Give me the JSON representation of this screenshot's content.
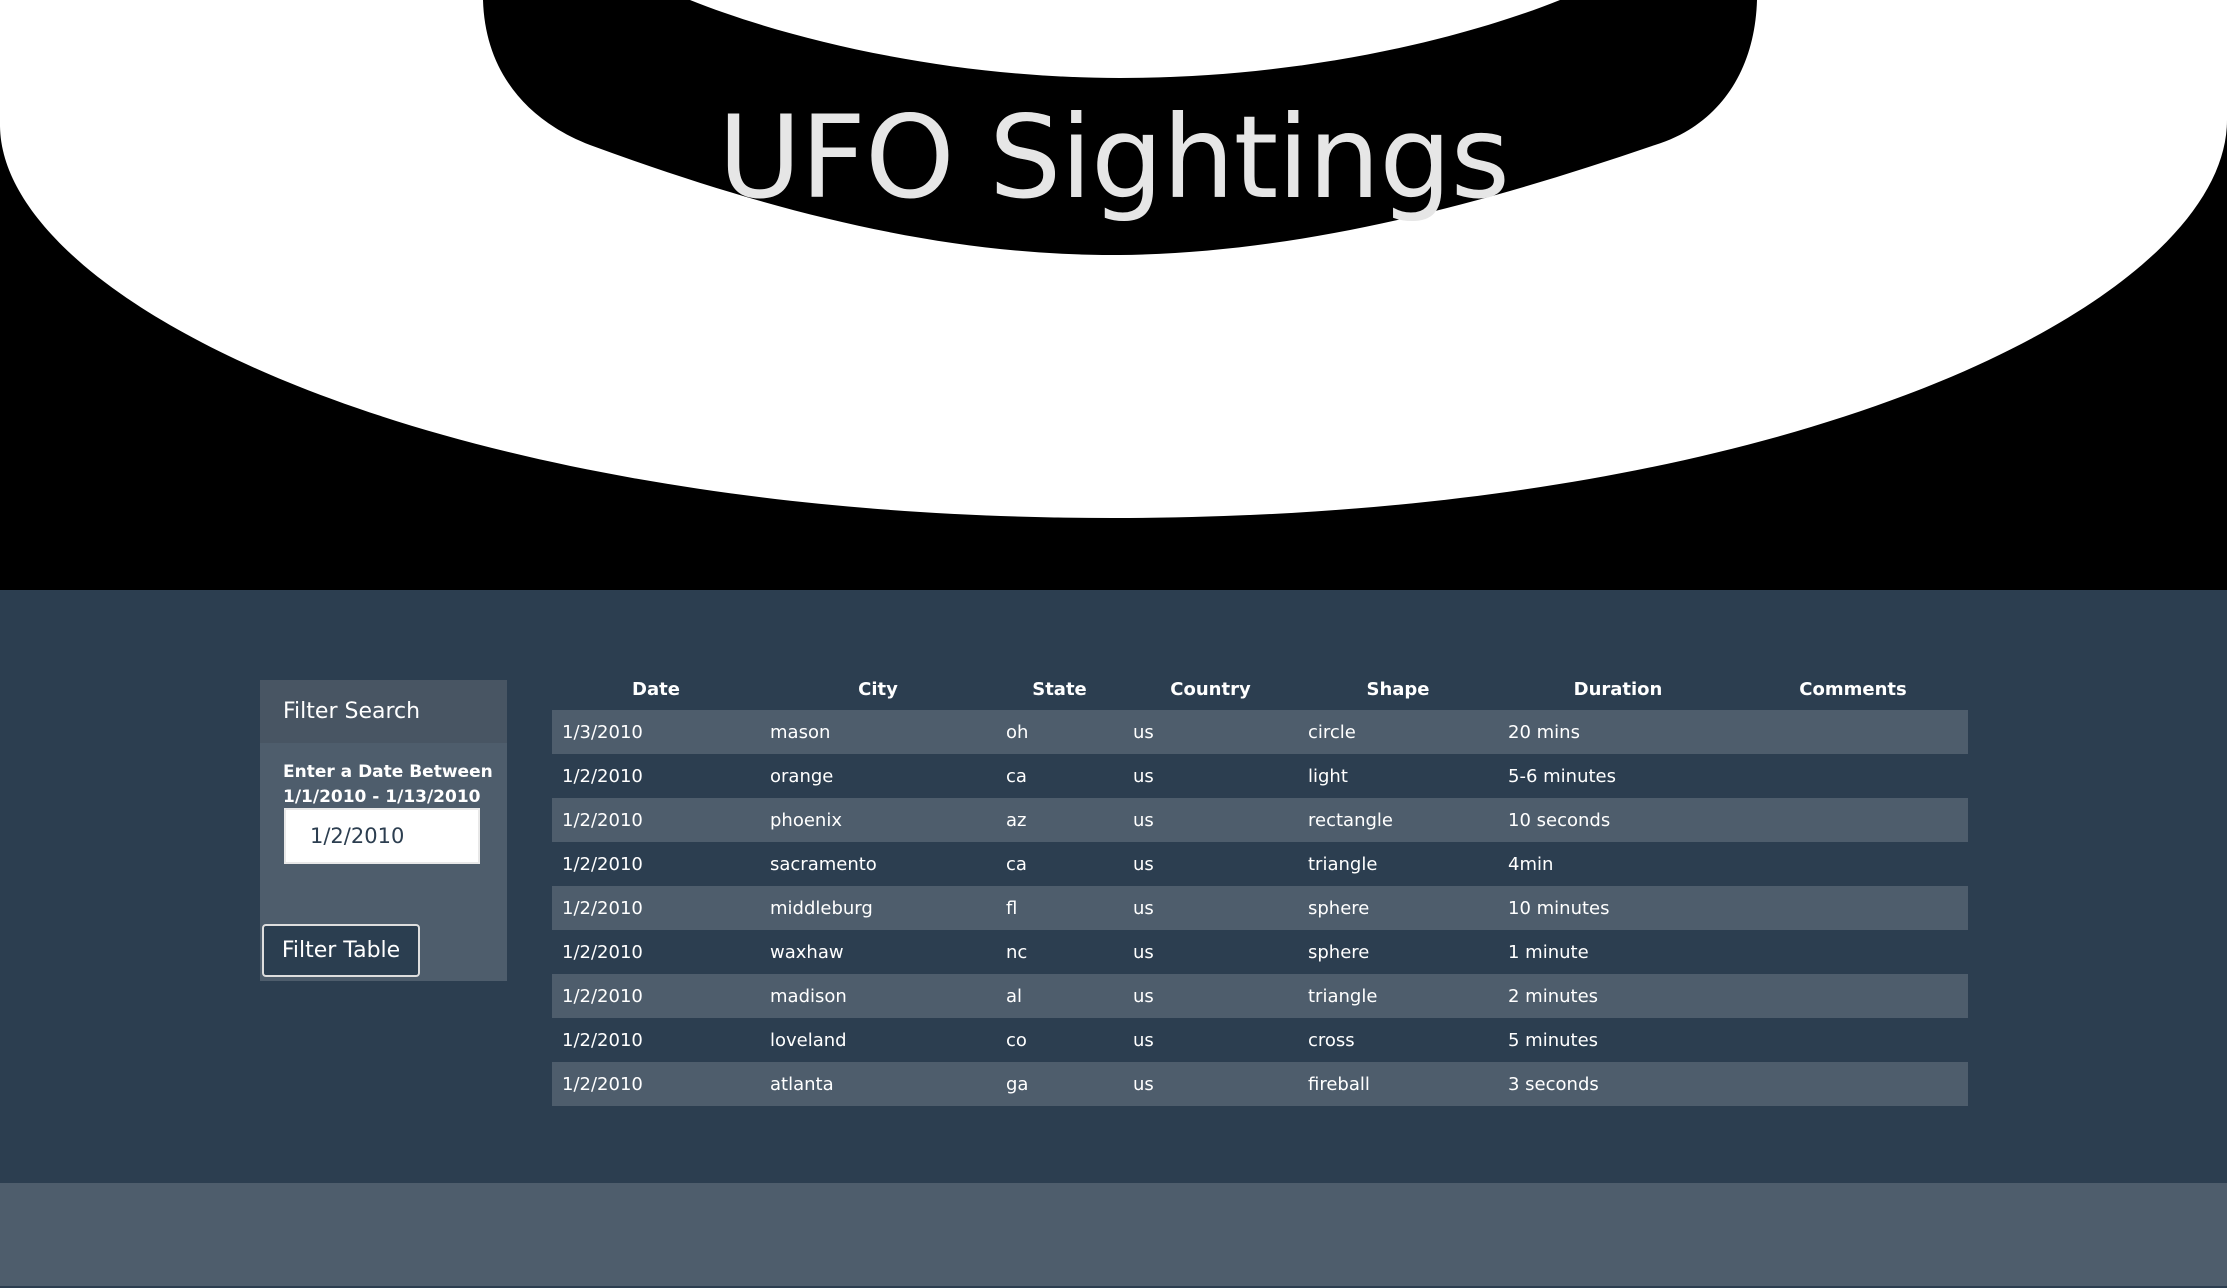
{
  "header": {
    "title": "UFO Sightings"
  },
  "filter": {
    "heading": "Filter Search",
    "label": "Enter a Date Between 1/1/2010 - 1/13/2010",
    "date_value": "1/2/2010",
    "button_label": "Filter Table"
  },
  "table": {
    "columns": [
      "Date",
      "City",
      "State",
      "Country",
      "Shape",
      "Duration",
      "Comments"
    ],
    "rows": [
      {
        "date": "1/3/2010",
        "city": "mason",
        "state": "oh",
        "country": "us",
        "shape": "circle",
        "duration": "20 mins",
        "comments": ""
      },
      {
        "date": "1/2/2010",
        "city": "orange",
        "state": "ca",
        "country": "us",
        "shape": "light",
        "duration": "5-6 minutes",
        "comments": ""
      },
      {
        "date": "1/2/2010",
        "city": "phoenix",
        "state": "az",
        "country": "us",
        "shape": "rectangle",
        "duration": "10 seconds",
        "comments": ""
      },
      {
        "date": "1/2/2010",
        "city": "sacramento",
        "state": "ca",
        "country": "us",
        "shape": "triangle",
        "duration": "4min",
        "comments": ""
      },
      {
        "date": "1/2/2010",
        "city": "middleburg",
        "state": "fl",
        "country": "us",
        "shape": "sphere",
        "duration": "10 minutes",
        "comments": ""
      },
      {
        "date": "1/2/2010",
        "city": "waxhaw",
        "state": "nc",
        "country": "us",
        "shape": "sphere",
        "duration": "1 minute",
        "comments": ""
      },
      {
        "date": "1/2/2010",
        "city": "madison",
        "state": "al",
        "country": "us",
        "shape": "triangle",
        "duration": "2 minutes",
        "comments": ""
      },
      {
        "date": "1/2/2010",
        "city": "loveland",
        "state": "co",
        "country": "us",
        "shape": "cross",
        "duration": "5 minutes",
        "comments": ""
      },
      {
        "date": "1/2/2010",
        "city": "atlanta",
        "state": "ga",
        "country": "us",
        "shape": "fireball",
        "duration": "3 seconds",
        "comments": ""
      }
    ]
  },
  "colors": {
    "page_background": "#2c3e50",
    "panel_background": "#4e5d6c",
    "hero_background": "#000000",
    "ufo_saucer": "#ffffff",
    "title_text": "#e6e6e6"
  }
}
